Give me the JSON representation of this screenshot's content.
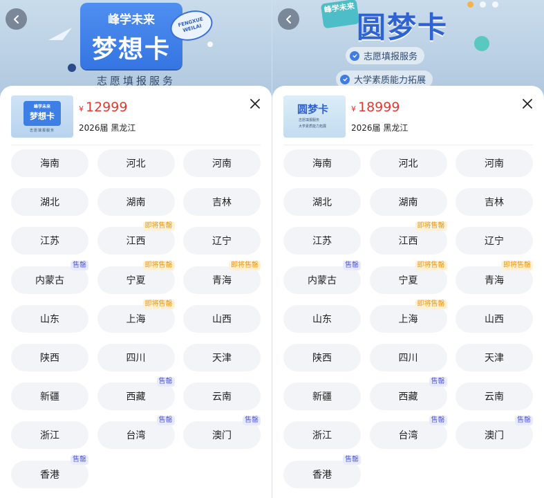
{
  "panels": [
    {
      "banner": {
        "brand_small": "峰学未来",
        "brand_big": "梦想卡",
        "stamp_line1": "FENGXUE",
        "stamp_line2": "WEILAI",
        "caption": "志愿填报服务"
      },
      "product": {
        "currency": "¥",
        "price": "12999",
        "meta": "2026届 黑龙江",
        "thumb_small": "峰学未来",
        "thumb_big": "梦想卡",
        "thumb_caption": "志愿填报服务"
      },
      "regions": [
        {
          "name": "海南",
          "tag": ""
        },
        {
          "name": "河北",
          "tag": ""
        },
        {
          "name": "河南",
          "tag": ""
        },
        {
          "name": "湖北",
          "tag": ""
        },
        {
          "name": "湖南",
          "tag": ""
        },
        {
          "name": "吉林",
          "tag": ""
        },
        {
          "name": "江苏",
          "tag": ""
        },
        {
          "name": "江西",
          "tag": "即将售罄"
        },
        {
          "name": "辽宁",
          "tag": ""
        },
        {
          "name": "内蒙古",
          "tag": "售罄"
        },
        {
          "name": "宁夏",
          "tag": "即将售罄"
        },
        {
          "name": "青海",
          "tag": "即将售罄"
        },
        {
          "name": "山东",
          "tag": ""
        },
        {
          "name": "上海",
          "tag": "即将售罄"
        },
        {
          "name": "山西",
          "tag": ""
        },
        {
          "name": "陕西",
          "tag": ""
        },
        {
          "name": "四川",
          "tag": ""
        },
        {
          "name": "天津",
          "tag": ""
        },
        {
          "name": "新疆",
          "tag": ""
        },
        {
          "name": "西藏",
          "tag": "售罄"
        },
        {
          "name": "云南",
          "tag": ""
        },
        {
          "name": "浙江",
          "tag": ""
        },
        {
          "name": "台湾",
          "tag": "售罄"
        },
        {
          "name": "澳门",
          "tag": "售罄"
        },
        {
          "name": "香港",
          "tag": "售罄"
        }
      ]
    },
    {
      "banner": {
        "ribbon": "峰学未来",
        "title": "圆梦卡",
        "feature1": "志愿填报服务",
        "feature2": "大学素质能力拓展"
      },
      "product": {
        "currency": "¥",
        "price": "18999",
        "meta": "2026届 黑龙江",
        "thumb_big": "圆梦卡",
        "thumb_line1": "志愿填报服务",
        "thumb_line2": "大学素质能力拓展"
      },
      "regions": [
        {
          "name": "海南",
          "tag": ""
        },
        {
          "name": "河北",
          "tag": ""
        },
        {
          "name": "河南",
          "tag": ""
        },
        {
          "name": "湖北",
          "tag": ""
        },
        {
          "name": "湖南",
          "tag": ""
        },
        {
          "name": "吉林",
          "tag": ""
        },
        {
          "name": "江苏",
          "tag": ""
        },
        {
          "name": "江西",
          "tag": "即将售罄"
        },
        {
          "name": "辽宁",
          "tag": ""
        },
        {
          "name": "内蒙古",
          "tag": "售罄"
        },
        {
          "name": "宁夏",
          "tag": "即将售罄"
        },
        {
          "name": "青海",
          "tag": "即将售罄"
        },
        {
          "name": "山东",
          "tag": ""
        },
        {
          "name": "上海",
          "tag": "即将售罄"
        },
        {
          "name": "山西",
          "tag": ""
        },
        {
          "name": "陕西",
          "tag": ""
        },
        {
          "name": "四川",
          "tag": ""
        },
        {
          "name": "天津",
          "tag": ""
        },
        {
          "name": "新疆",
          "tag": ""
        },
        {
          "name": "西藏",
          "tag": "售罄"
        },
        {
          "name": "云南",
          "tag": ""
        },
        {
          "name": "浙江",
          "tag": ""
        },
        {
          "name": "台湾",
          "tag": "售罄"
        },
        {
          "name": "澳门",
          "tag": "售罄"
        },
        {
          "name": "香港",
          "tag": "售罄"
        }
      ]
    }
  ],
  "colors": {
    "price": "#e03b33",
    "chip_bg": "#f2f4f7",
    "sold_out_tag_text": "#5c63d8",
    "almost_sold_tag_text": "#ef9a1a"
  },
  "icons": [
    "back-arrow-icon",
    "close-icon",
    "check-icon"
  ]
}
